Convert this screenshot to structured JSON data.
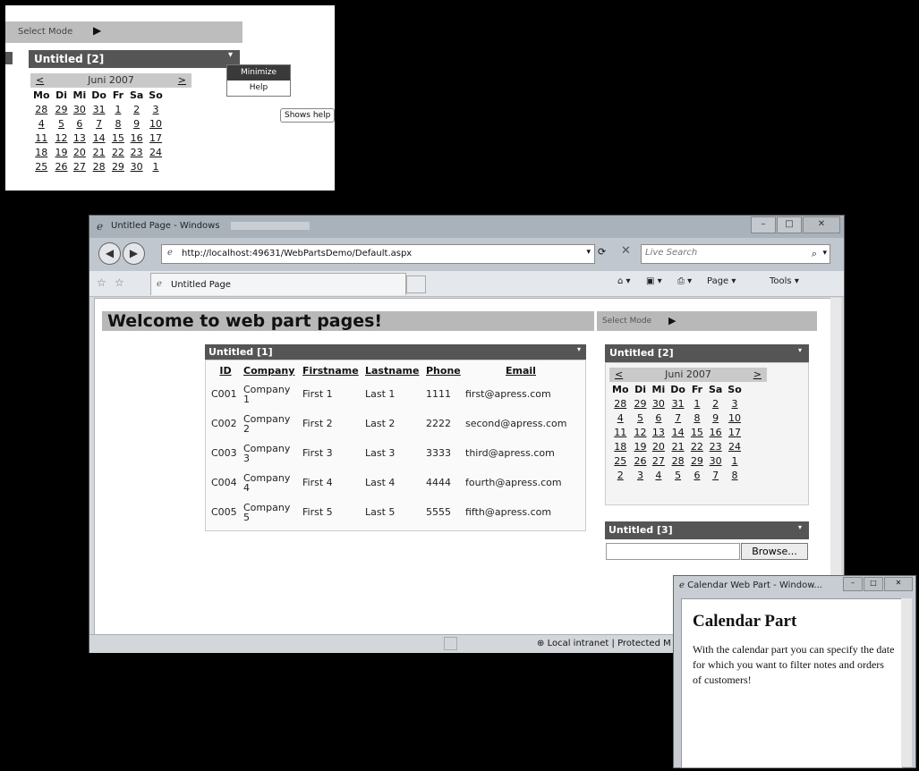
{
  "inset": {
    "select_mode": "Select Mode",
    "webpart_title": "Untitled [2]",
    "menu": [
      "Minimize",
      "Help"
    ],
    "tooltip": "Shows help",
    "calendar": {
      "prev": "<",
      "next": ">",
      "month": "Juni 2007",
      "days": [
        "Mo",
        "Di",
        "Mi",
        "Do",
        "Fr",
        "Sa",
        "So"
      ],
      "weeks": [
        [
          "28",
          "29",
          "30",
          "31",
          "1",
          "2",
          "3"
        ],
        [
          "4",
          "5",
          "6",
          "7",
          "8",
          "9",
          "10"
        ],
        [
          "11",
          "12",
          "13",
          "14",
          "15",
          "16",
          "17"
        ],
        [
          "18",
          "19",
          "20",
          "21",
          "22",
          "23",
          "24"
        ],
        [
          "25",
          "26",
          "27",
          "28",
          "29",
          "30",
          "1"
        ]
      ]
    }
  },
  "browser": {
    "title": "Untitled Page - Windows",
    "address": "http://localhost:49631/WebPartsDemo/Default.aspx",
    "search_placeholder": "Live Search",
    "tab_label": "Untitled Page",
    "page_menu": "Page ▾",
    "tools_menu": "Tools ▾",
    "status_zone": "Local intranet | Protected M"
  },
  "page": {
    "heading": "Welcome to web part pages!",
    "select_mode": "Select Mode",
    "wp1": {
      "title": "Untitled [1]",
      "columns": [
        "ID",
        "Company",
        "Firstname",
        "Lastname",
        "Phone",
        "Email"
      ],
      "rows": [
        [
          "C001",
          "Company",
          "1",
          "First 1",
          "Last 1",
          "1111",
          "first@apress.com"
        ],
        [
          "C002",
          "Company",
          "2",
          "First 2",
          "Last 2",
          "2222",
          "second@apress.com"
        ],
        [
          "C003",
          "Company",
          "3",
          "First 3",
          "Last 3",
          "3333",
          "third@apress.com"
        ],
        [
          "C004",
          "Company",
          "4",
          "First 4",
          "Last 4",
          "4444",
          "fourth@apress.com"
        ],
        [
          "C005",
          "Company",
          "5",
          "First 5",
          "Last 5",
          "5555",
          "fifth@apress.com"
        ]
      ]
    },
    "wp2": {
      "title": "Untitled [2]",
      "calendar": {
        "prev": "<",
        "next": ">",
        "month": "Juni 2007",
        "days": [
          "Mo",
          "Di",
          "Mi",
          "Do",
          "Fr",
          "Sa",
          "So"
        ],
        "weeks": [
          [
            "28",
            "29",
            "30",
            "31",
            "1",
            "2",
            "3"
          ],
          [
            "4",
            "5",
            "6",
            "7",
            "8",
            "9",
            "10"
          ],
          [
            "11",
            "12",
            "13",
            "14",
            "15",
            "16",
            "17"
          ],
          [
            "18",
            "19",
            "20",
            "21",
            "22",
            "23",
            "24"
          ],
          [
            "25",
            "26",
            "27",
            "28",
            "29",
            "30",
            "1"
          ],
          [
            "2",
            "3",
            "4",
            "5",
            "6",
            "7",
            "8"
          ]
        ]
      }
    },
    "wp3": {
      "title": "Untitled [3]",
      "browse_label": "Browse..."
    }
  },
  "popup": {
    "title": "Calendar Web Part - Window...",
    "heading": "Calendar Part",
    "text": "With the calendar part you can specify the date for which you want to filter notes and orders of customers!"
  }
}
